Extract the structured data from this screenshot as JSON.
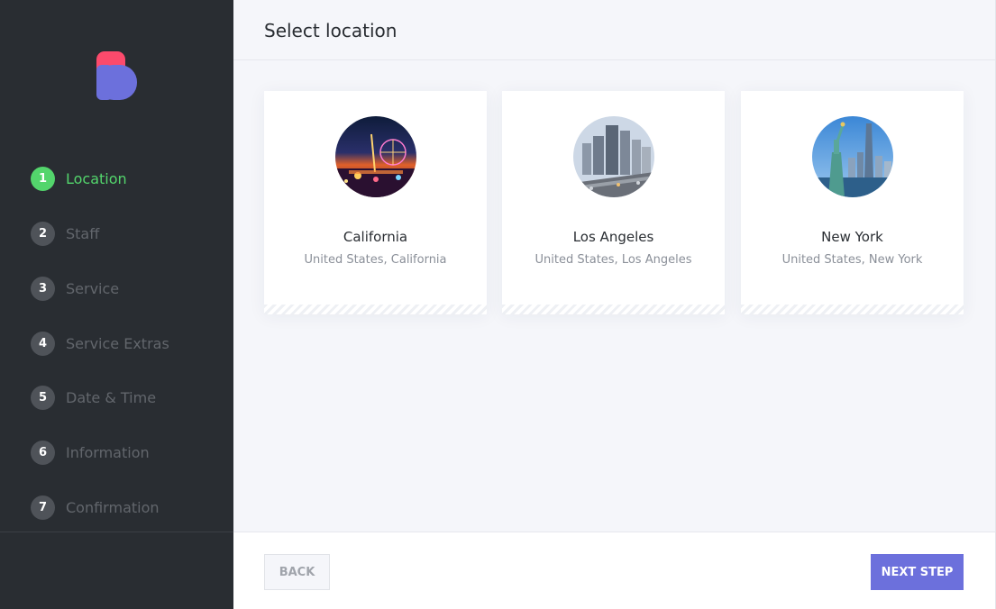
{
  "brand": {
    "logo_icon": "booknetic-logo-icon",
    "colors": {
      "top": "#fc4a6c",
      "bottom": "#6c70dc"
    }
  },
  "steps": [
    {
      "num": "1",
      "label": "Location",
      "active": true
    },
    {
      "num": "2",
      "label": "Staff"
    },
    {
      "num": "3",
      "label": "Service"
    },
    {
      "num": "4",
      "label": "Service Extras"
    },
    {
      "num": "5",
      "label": "Date & Time"
    },
    {
      "num": "6",
      "label": "Information"
    },
    {
      "num": "7",
      "label": "Confirmation"
    }
  ],
  "header": {
    "title": "Select location"
  },
  "locations": [
    {
      "name": "California",
      "address": "United States, California",
      "image": "california-night-fair-photo"
    },
    {
      "name": "Los Angeles",
      "address": "United States, Los Angeles",
      "image": "los-angeles-skyline-photo"
    },
    {
      "name": "New York",
      "address": "United States, New York",
      "image": "new-york-statue-of-liberty-photo"
    }
  ],
  "footer": {
    "back_label": "BACK",
    "next_label": "NEXT STEP"
  },
  "colors": {
    "sidebar_bg": "#292d32",
    "active_step": "#53d56c",
    "accent": "#6c70dc"
  }
}
